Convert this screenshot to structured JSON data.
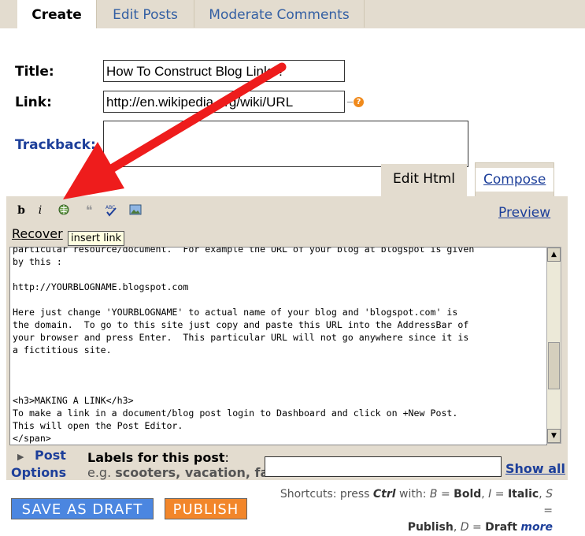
{
  "tabs": {
    "create": "Create",
    "edit_posts": "Edit Posts",
    "moderate_comments": "Moderate Comments"
  },
  "form": {
    "title_label": "Title:",
    "title_value": "How To Construct Blog Links?",
    "link_label": "Link:",
    "link_value": "http://en.wikipedia.org/wiki/URL",
    "help_glyph": "?",
    "trackback_label": "Trackback:",
    "trackback_value": ""
  },
  "editor": {
    "mode_edit_html": "Edit Html",
    "mode_compose": "Compose",
    "toolbar": {
      "bold": "b",
      "italic": "i",
      "link_icon": "insert-link-icon",
      "quote": "❝",
      "spell": "ABC",
      "image_icon": "image-icon"
    },
    "preview": "Preview",
    "recover": "Recover",
    "tooltip": "insert link",
    "lines": [
      "particular resource/document.  For example the URL of your blog at blogspot is given",
      "by this :",
      "",
      "http://YOURBLOGNAME.blogspot.com",
      "",
      "Here just change 'YOURBLOGNAME' to actual name of your blog and 'blogspot.com' is",
      "the domain.  To go to this site just copy and paste this URL into the AddressBar of",
      "your browser and press Enter.  This particular URL will not go anywhere since it is",
      "a fictitious site.",
      "",
      "",
      "",
      "<h3>MAKING A LINK</h3>",
      "To make a link in a document/blog post login to Dashboard and click on +New Post.",
      "This will open the Post Editor.",
      "</span>"
    ]
  },
  "post_options": {
    "line1": "Post",
    "line2": "Options"
  },
  "labels": {
    "title": "Labels for this post",
    "colon": ":",
    "hint_prefix": "e.g. ",
    "hint_examples": "scooters, vacation, fall",
    "value": "",
    "show_all": "Show all"
  },
  "buttons": {
    "save_draft": "SAVE AS DRAFT",
    "publish": "PUBLISH"
  },
  "shortcuts": {
    "prefix": "Shortcuts: press ",
    "ctrl": "Ctrl",
    "with": " with: ",
    "b_key": "B",
    "b_eq": " = ",
    "b_name": "Bold",
    "sep1": ", ",
    "i_key": "I",
    "i_eq": " = ",
    "i_name": "Italic",
    "sep2": ", ",
    "s_key": "S",
    "s_eq": " =",
    "s_name": "Publish",
    "sep3": ", ",
    "d_key": "D",
    "d_eq": " = ",
    "d_name": "Draft",
    "more": "more"
  },
  "colors": {
    "accent_blue": "#1d3f9a",
    "tan": "#e3dccf",
    "save_blue": "#4b86e0",
    "publish_orange": "#f2862a",
    "arrow_red": "#ee1c1c"
  }
}
